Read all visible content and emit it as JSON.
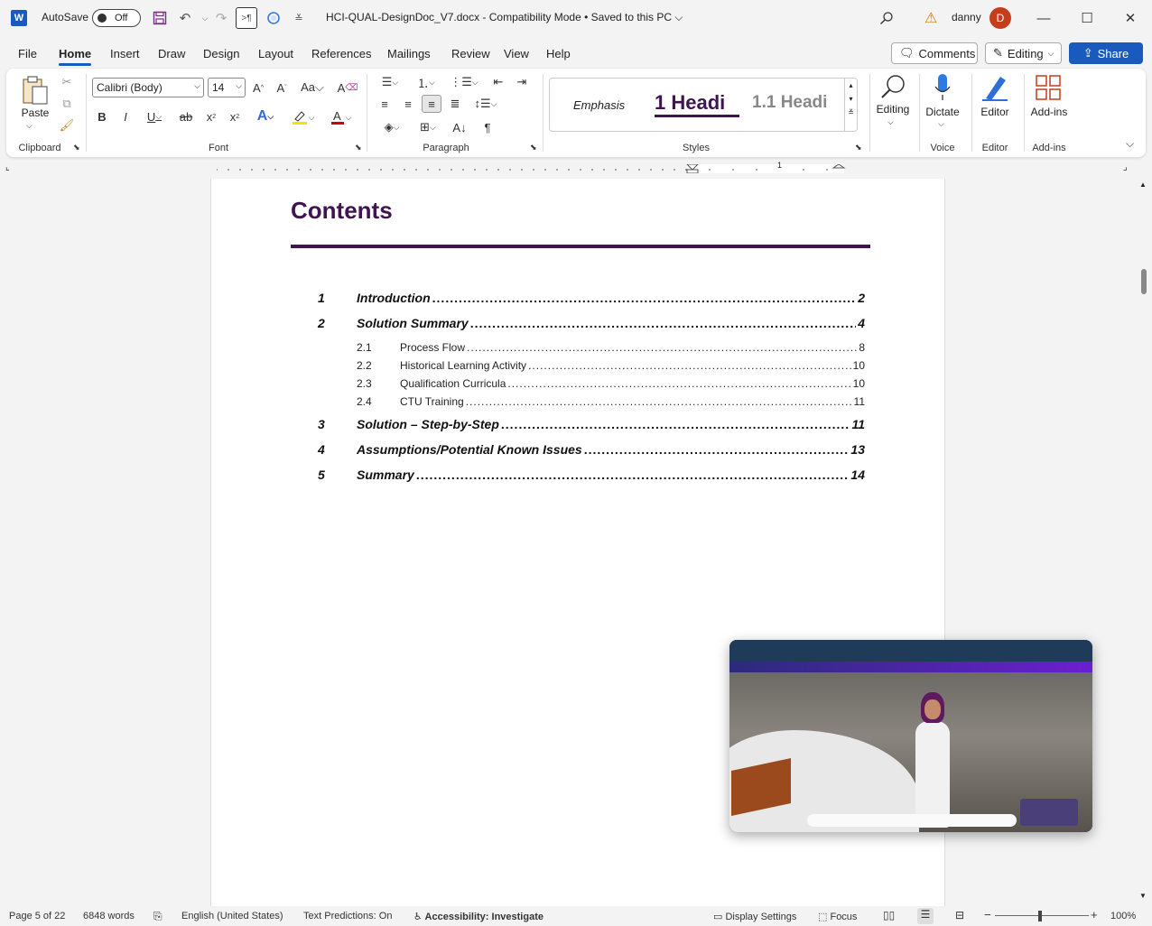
{
  "titlebar": {
    "app_letter": "W",
    "autosave_label": "AutoSave",
    "autosave_state": "Off",
    "doc_title": "HCI-QUAL-DesignDoc_V7.docx  -  Compatibility Mode  •  Saved to this PC",
    "user_name": "danny",
    "user_initial": "D"
  },
  "menu": {
    "tabs": [
      "File",
      "Home",
      "Insert",
      "Draw",
      "Design",
      "Layout",
      "References",
      "Mailings",
      "Review",
      "View",
      "Help"
    ],
    "active": "Home",
    "comments_label": "Comments",
    "editing_label": "Editing",
    "share_label": "Share"
  },
  "ribbon": {
    "clipboard": {
      "paste_label": "Paste",
      "group_label": "Clipboard"
    },
    "font": {
      "font_name": "Calibri (Body)",
      "font_size": "14",
      "group_label": "Font"
    },
    "paragraph": {
      "group_label": "Paragraph"
    },
    "styles": {
      "group_label": "Styles",
      "items": [
        {
          "label": "Emphasis"
        },
        {
          "label": "1  Headi"
        },
        {
          "label": "1.1  Headi"
        }
      ]
    },
    "editing": {
      "label": "Editing"
    },
    "voice": {
      "dictate_label": "Dictate",
      "group_label": "Voice"
    },
    "editor": {
      "label": "Editor",
      "group_label": "Editor"
    },
    "addins": {
      "label": "Add-ins",
      "group_label": "Add-ins"
    }
  },
  "ruler": {
    "marker": "1"
  },
  "document": {
    "title": "Contents",
    "toc": [
      {
        "num": "1",
        "text": "Introduction",
        "page": "2",
        "level": 1
      },
      {
        "num": "2",
        "text": "Solution Summary",
        "page": "4",
        "level": 1
      },
      {
        "num": "2.1",
        "text": "Process Flow",
        "page": "8",
        "level": 2
      },
      {
        "num": "2.2",
        "text": "Historical Learning Activity",
        "page": "10",
        "level": 2
      },
      {
        "num": "2.3",
        "text": "Qualification Curricula",
        "page": "10",
        "level": 2
      },
      {
        "num": "2.4",
        "text": "CTU Training",
        "page": "11",
        "level": 2
      },
      {
        "num": "3",
        "text": "Solution – Step-by-Step",
        "page": "11",
        "level": 1
      },
      {
        "num": "4",
        "text": "Assumptions/Potential Known Issues",
        "page": "13",
        "level": 1
      },
      {
        "num": "5",
        "text": "Summary",
        "page": "14",
        "level": 1
      }
    ]
  },
  "statusbar": {
    "page": "Page 5 of 22",
    "words": "6848 words",
    "language": "English (United States)",
    "predictions": "Text Predictions: On",
    "accessibility": "Accessibility: Investigate",
    "display_settings": "Display Settings",
    "focus": "Focus",
    "zoom": "100%"
  },
  "colors": {
    "accent": "#185abd",
    "heading": "#3f1451"
  }
}
